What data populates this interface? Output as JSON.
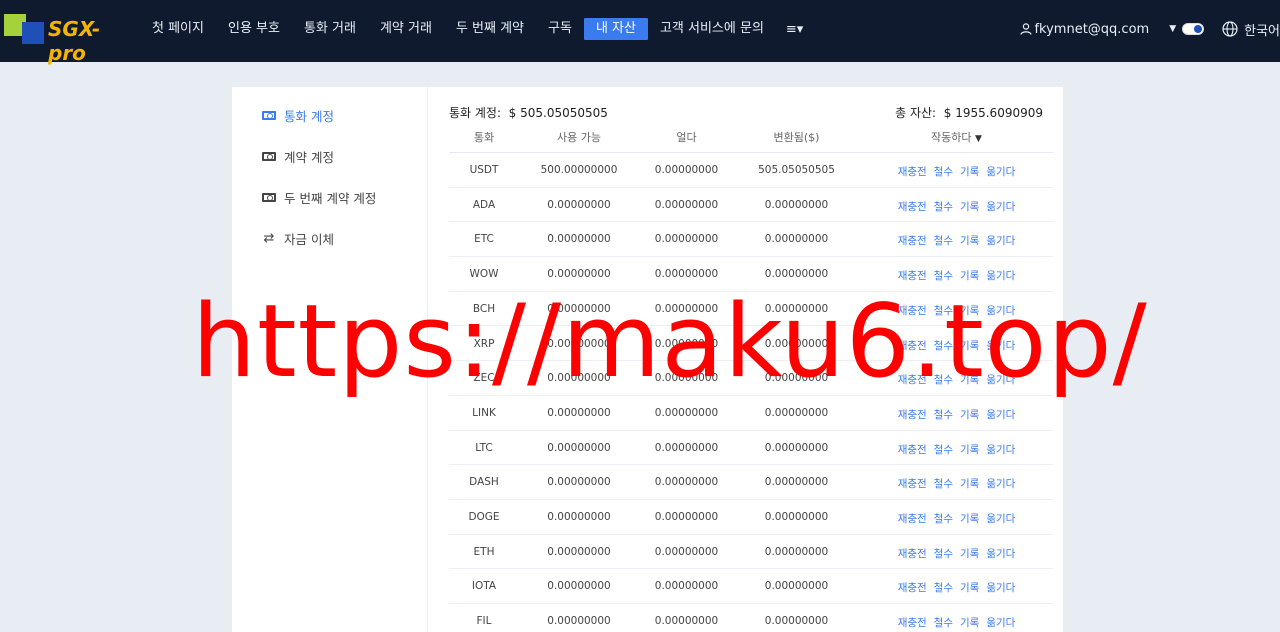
{
  "header": {
    "logo_text": "SGX-pro",
    "nav": [
      "첫 페이지",
      "인용 부호",
      "통화 거래",
      "계약 거래",
      "두 번째 계약",
      "구독",
      "내 자산",
      "고객 서비스에 문의"
    ],
    "active_nav": "내 자산",
    "menu_icon": "≡▾",
    "user_email": "fkymnet@qq.com",
    "language": "한국어"
  },
  "sidebar": {
    "items": [
      {
        "label": "통화 계정",
        "icon": "money-icon"
      },
      {
        "label": "계약 계정",
        "icon": "money-icon"
      },
      {
        "label": "두 번째 계약 계정",
        "icon": "money-icon"
      },
      {
        "label": "자금 이체",
        "icon": "swap-icon"
      }
    ]
  },
  "summary": {
    "account_label": "통화 계정:",
    "account_value": "$ 505.05050505",
    "total_label": "총 자산:",
    "total_value": "$ 1955.6090909"
  },
  "table": {
    "headers": [
      "통화",
      "사용 가능",
      "얼다",
      "변환됨($)",
      "작동하다"
    ],
    "action_labels": [
      "재충전",
      "철수",
      "기록",
      "옮기다"
    ],
    "rows": [
      [
        "USDT",
        "500.00000000",
        "0.00000000",
        "505.05050505"
      ],
      [
        "ADA",
        "0.00000000",
        "0.00000000",
        "0.00000000"
      ],
      [
        "ETC",
        "0.00000000",
        "0.00000000",
        "0.00000000"
      ],
      [
        "WOW",
        "0.00000000",
        "0.00000000",
        "0.00000000"
      ],
      [
        "BCH",
        "0.00000000",
        "0.00000000",
        "0.00000000"
      ],
      [
        "XRP",
        "0.00000000",
        "0.00000000",
        "0.00000000"
      ],
      [
        "ZEC",
        "0.00000000",
        "0.00000000",
        "0.00000000"
      ],
      [
        "LINK",
        "0.00000000",
        "0.00000000",
        "0.00000000"
      ],
      [
        "LTC",
        "0.00000000",
        "0.00000000",
        "0.00000000"
      ],
      [
        "DASH",
        "0.00000000",
        "0.00000000",
        "0.00000000"
      ],
      [
        "DOGE",
        "0.00000000",
        "0.00000000",
        "0.00000000"
      ],
      [
        "ETH",
        "0.00000000",
        "0.00000000",
        "0.00000000"
      ],
      [
        "IOTA",
        "0.00000000",
        "0.00000000",
        "0.00000000"
      ],
      [
        "FIL",
        "0.00000000",
        "0.00000000",
        "0.00000000"
      ]
    ]
  },
  "watermark": "https://maku6.top/",
  "colors": {
    "header_bg": "#0f1a2e",
    "accent": "#3a7bf0",
    "page_bg": "#e8ecf3",
    "watermark": "#ff0000"
  }
}
